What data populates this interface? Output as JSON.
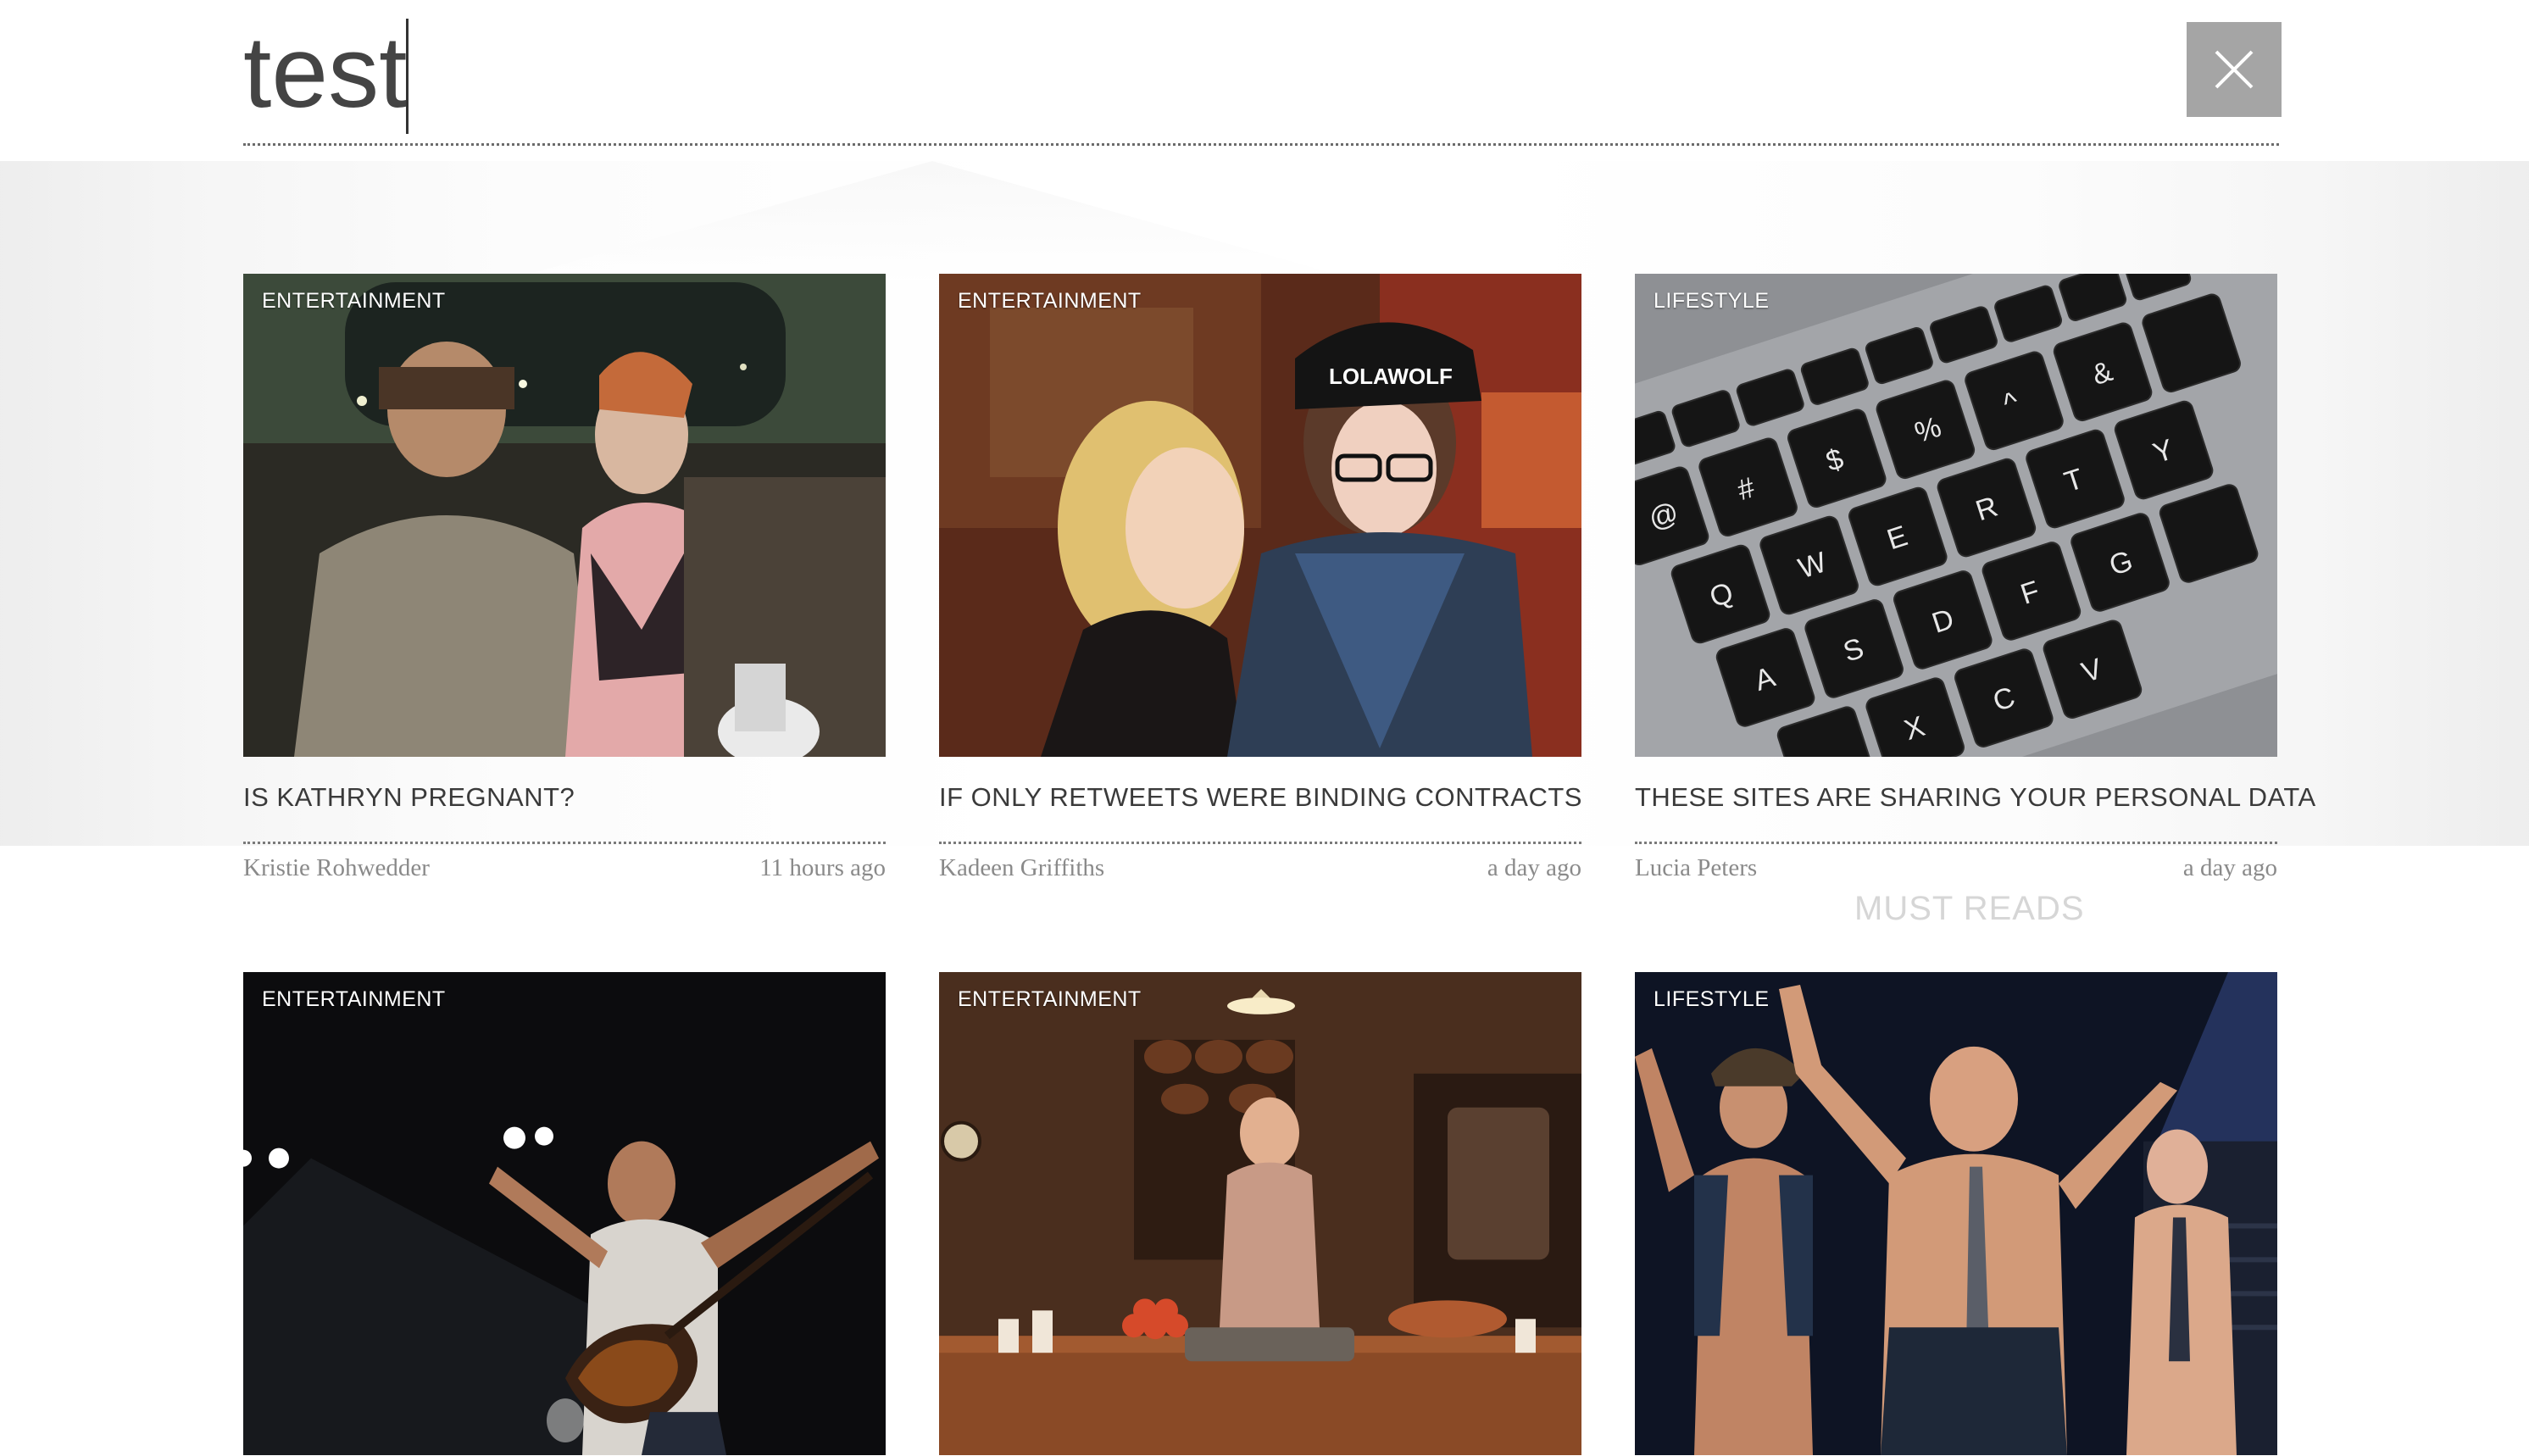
{
  "search": {
    "query": "test"
  },
  "close_icon": "close-icon",
  "background": {
    "ghost_section_title": "MUST READS"
  },
  "results": [
    {
      "category": "ENTERTAINMENT",
      "title": "IS KATHRYN PREGNANT?",
      "author": "Kristie Rohwedder",
      "time": "11 hours ago"
    },
    {
      "category": "ENTERTAINMENT",
      "title": "IF ONLY RETWEETS WERE BINDING CONTRACTS",
      "author": "Kadeen Griffiths",
      "time": "a day ago"
    },
    {
      "category": "LIFESTYLE",
      "title": "THESE SITES ARE SHARING YOUR PERSONAL DATA",
      "author": "Lucia Peters",
      "time": "a day ago"
    },
    {
      "category": "ENTERTAINMENT"
    },
    {
      "category": "ENTERTAINMENT"
    },
    {
      "category": "LIFESTYLE"
    }
  ]
}
